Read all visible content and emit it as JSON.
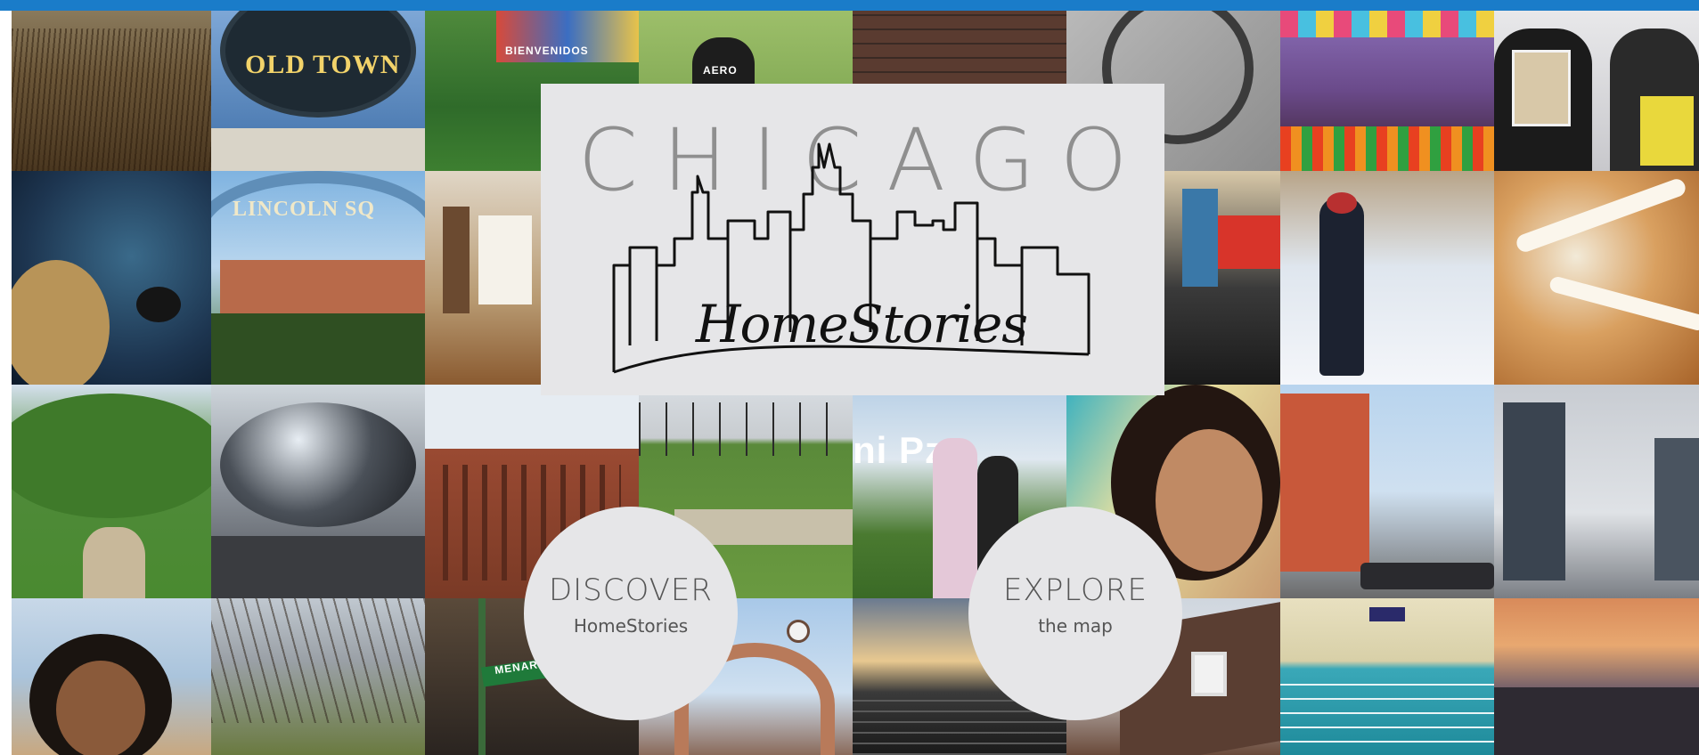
{
  "hero": {
    "title": "CHICAGO",
    "script_title": "HomeStories"
  },
  "discover": {
    "title": "DISCOVER",
    "subtitle": "HomeStories"
  },
  "explore": {
    "title": "EXPLORE",
    "subtitle": "the map"
  },
  "photo_signs": {
    "old_town": "OLD TOWN",
    "lincoln_square": "LINCOLN SQ",
    "bienvenidos": "BIENVENIDOS",
    "shirt": "AERO",
    "street_sign": "MENARD",
    "millennium": "ni Pza"
  },
  "colors": {
    "top_bar": "#1a7cc9",
    "overlay": "#e6e6e8",
    "title_text": "#8f8f8f",
    "button_text": "#555555"
  }
}
